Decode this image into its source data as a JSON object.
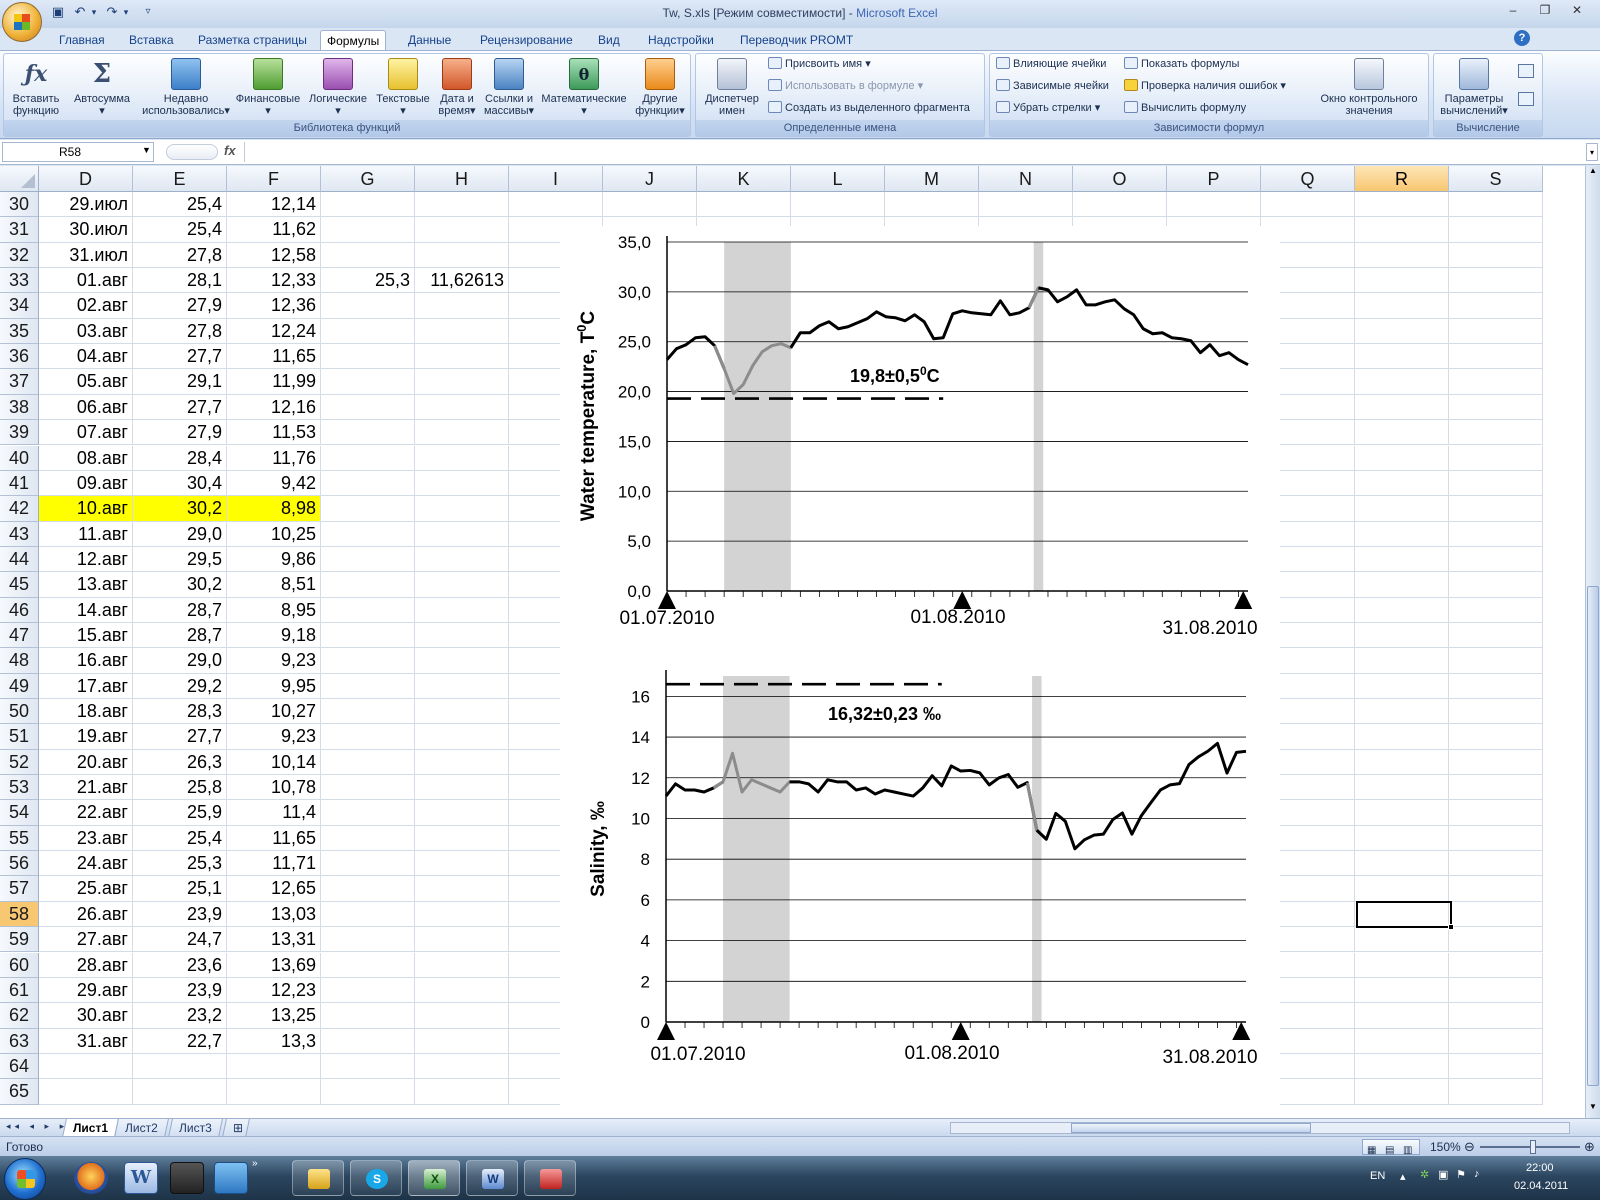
{
  "window": {
    "title_file": "Tw, S.xls  [Режим совместимости] - ",
    "title_app": "Microsoft Excel",
    "help_glyph": "?"
  },
  "ribbon_tabs": [
    "Главная",
    "Вставка",
    "Разметка страницы",
    "Формулы",
    "Данные",
    "Рецензирование",
    "Вид",
    "Надстройки",
    "Переводчик PROMT"
  ],
  "ribbon": {
    "library": {
      "label": "Библиотека функций",
      "insert_fn_line1": "Вставить",
      "insert_fn_line2": "функцию",
      "autosum": "Автосумма",
      "recent_line1": "Недавно",
      "recent_line2": "использовались",
      "financial": "Финансовые",
      "logical": "Логические",
      "text": "Текстовые",
      "datetime_line1": "Дата и",
      "datetime_line2": "время",
      "lookup_line1": "Ссылки и",
      "lookup_line2": "массивы",
      "math": "Математические",
      "other_line1": "Другие",
      "other_line2": "функции"
    },
    "names": {
      "label": "Определенные имена",
      "manager_line1": "Диспетчер",
      "manager_line2": "имен",
      "define": "Присвоить имя",
      "use_in_formula": "Использовать в формуле",
      "create_from_sel": "Создать из выделенного фрагмента"
    },
    "audit": {
      "label": "Зависимости формул",
      "precedents": "Влияющие ячейки",
      "dependents": "Зависимые ячейки",
      "remove_arrows": "Убрать стрелки",
      "show_formulas": "Показать формулы",
      "error_check": "Проверка наличия ошибок",
      "evaluate": "Вычислить формулу",
      "watch_line1": "Окно контрольного",
      "watch_line2": "значения"
    },
    "calc": {
      "label": "Вычисление",
      "options_line1": "Параметры",
      "options_line2": "вычислений"
    }
  },
  "formula_bar": {
    "name_box": "R58",
    "fx": "fx",
    "formula": ""
  },
  "columns": [
    "D",
    "E",
    "F",
    "G",
    "H",
    "I",
    "J",
    "K",
    "L",
    "M",
    "N",
    "O",
    "P",
    "Q",
    "R",
    "S"
  ],
  "selected_column": "R",
  "rows": [
    {
      "n": "30",
      "d": "29.июл",
      "e": "25,4",
      "f": "12,14"
    },
    {
      "n": "31",
      "d": "30.июл",
      "e": "25,4",
      "f": "11,62"
    },
    {
      "n": "32",
      "d": "31.июл",
      "e": "27,8",
      "f": "12,58"
    },
    {
      "n": "33",
      "d": "01.авг",
      "e": "28,1",
      "f": "12,33",
      "g": "25,3",
      "h": "11,62613"
    },
    {
      "n": "34",
      "d": "02.авг",
      "e": "27,9",
      "f": "12,36"
    },
    {
      "n": "35",
      "d": "03.авг",
      "e": "27,8",
      "f": "12,24"
    },
    {
      "n": "36",
      "d": "04.авг",
      "e": "27,7",
      "f": "11,65"
    },
    {
      "n": "37",
      "d": "05.авг",
      "e": "29,1",
      "f": "11,99"
    },
    {
      "n": "38",
      "d": "06.авг",
      "e": "27,7",
      "f": "12,16"
    },
    {
      "n": "39",
      "d": "07.авг",
      "e": "27,9",
      "f": "11,53"
    },
    {
      "n": "40",
      "d": "08.авг",
      "e": "28,4",
      "f": "11,76"
    },
    {
      "n": "41",
      "d": "09.авг",
      "e": "30,4",
      "f": "9,42"
    },
    {
      "n": "42",
      "d": "10.авг",
      "e": "30,2",
      "f": "8,98",
      "hl": true
    },
    {
      "n": "43",
      "d": "11.авг",
      "e": "29,0",
      "f": "10,25"
    },
    {
      "n": "44",
      "d": "12.авг",
      "e": "29,5",
      "f": "9,86"
    },
    {
      "n": "45",
      "d": "13.авг",
      "e": "30,2",
      "f": "8,51"
    },
    {
      "n": "46",
      "d": "14.авг",
      "e": "28,7",
      "f": "8,95"
    },
    {
      "n": "47",
      "d": "15.авг",
      "e": "28,7",
      "f": "9,18"
    },
    {
      "n": "48",
      "d": "16.авг",
      "e": "29,0",
      "f": "9,23"
    },
    {
      "n": "49",
      "d": "17.авг",
      "e": "29,2",
      "f": "9,95"
    },
    {
      "n": "50",
      "d": "18.авг",
      "e": "28,3",
      "f": "10,27"
    },
    {
      "n": "51",
      "d": "19.авг",
      "e": "27,7",
      "f": "9,23"
    },
    {
      "n": "52",
      "d": "20.авг",
      "e": "26,3",
      "f": "10,14"
    },
    {
      "n": "53",
      "d": "21.авг",
      "e": "25,8",
      "f": "10,78"
    },
    {
      "n": "54",
      "d": "22.авг",
      "e": "25,9",
      "f": "11,4"
    },
    {
      "n": "55",
      "d": "23.авг",
      "e": "25,4",
      "f": "11,65"
    },
    {
      "n": "56",
      "d": "24.авг",
      "e": "25,3",
      "f": "11,71"
    },
    {
      "n": "57",
      "d": "25.авг",
      "e": "25,1",
      "f": "12,65"
    },
    {
      "n": "58",
      "d": "26.авг",
      "e": "23,9",
      "f": "13,03",
      "sel": true
    },
    {
      "n": "59",
      "d": "27.авг",
      "e": "24,7",
      "f": "13,31"
    },
    {
      "n": "60",
      "d": "28.авг",
      "e": "23,6",
      "f": "13,69"
    },
    {
      "n": "61",
      "d": "29.авг",
      "e": "23,9",
      "f": "12,23"
    },
    {
      "n": "62",
      "d": "30.авг",
      "e": "23,2",
      "f": "13,25"
    },
    {
      "n": "63",
      "d": "31.авг",
      "e": "22,7",
      "f": "13,3"
    },
    {
      "n": "64",
      "d": "",
      "e": "",
      "f": ""
    },
    {
      "n": "65",
      "d": "",
      "e": "",
      "f": ""
    }
  ],
  "chart_data": [
    {
      "type": "line",
      "ylabel": "Water temperature, T",
      "ylabel_sup": "0",
      "ylabel_unit": "C",
      "ylim": [
        0,
        35
      ],
      "yticks": [
        "0,0",
        "5,0",
        "10,0",
        "15,0",
        "20,0",
        "25,0",
        "30,0",
        "35,0"
      ],
      "date_labels": [
        "01.07.2010",
        "01.08.2010",
        "31.08.2010"
      ],
      "annotation": "19,8±0,5",
      "annotation_sup": "0",
      "annotation_unit": "C",
      "reference_value": 19.3,
      "reference_extent_days": [
        0,
        29
      ],
      "shaded_day_ranges": [
        [
          6,
          13
        ],
        [
          38.5,
          39.5
        ]
      ],
      "grid": true,
      "x_days": [
        0,
        1,
        2,
        3,
        4,
        5,
        6,
        7,
        8,
        9,
        10,
        11,
        12,
        13,
        14,
        15,
        16,
        17,
        18,
        19,
        20,
        21,
        22,
        23,
        24,
        25,
        26,
        27,
        28,
        29,
        30,
        31,
        32,
        33,
        34,
        35,
        36,
        37,
        38,
        39,
        40,
        41,
        42,
        43,
        44,
        45,
        46,
        47,
        48,
        49,
        50,
        51,
        52,
        53,
        54,
        55,
        56,
        57,
        58,
        59,
        60,
        61
      ],
      "values": [
        23.2,
        24.3,
        24.7,
        25.4,
        25.5,
        24.6,
        22.3,
        19.8,
        20.7,
        22.6,
        24.0,
        24.6,
        24.8,
        24.4,
        25.9,
        25.9,
        26.6,
        27.0,
        26.3,
        26.5,
        26.9,
        27.3,
        28.0,
        27.5,
        27.4,
        27.1,
        27.7,
        27.0,
        25.3,
        25.4,
        27.8,
        28.1,
        27.9,
        27.8,
        27.7,
        29.1,
        27.7,
        27.9,
        28.4,
        30.4,
        30.2,
        29.0,
        29.5,
        30.2,
        28.7,
        28.7,
        29.0,
        29.2,
        28.3,
        27.7,
        26.3,
        25.8,
        25.9,
        25.4,
        25.3,
        25.1,
        23.9,
        24.7,
        23.6,
        23.9,
        23.2,
        22.7
      ]
    },
    {
      "type": "line",
      "ylabel": "Salinity, ‰",
      "ylim": [
        0,
        17
      ],
      "yticks": [
        "0",
        "2",
        "4",
        "6",
        "8",
        "10",
        "12",
        "14",
        "16"
      ],
      "date_labels": [
        "01.07.2010",
        "01.08.2010",
        "31.08.2010"
      ],
      "annotation": "16,32±0,23 ‰",
      "reference_value": 16.6,
      "reference_extent_days": [
        0,
        29
      ],
      "shaded_day_ranges": [
        [
          6,
          13
        ],
        [
          38.5,
          39.5
        ]
      ],
      "grid": true,
      "x_days": [
        0,
        1,
        2,
        3,
        4,
        5,
        6,
        7,
        8,
        9,
        10,
        11,
        12,
        13,
        14,
        15,
        16,
        17,
        18,
        19,
        20,
        21,
        22,
        23,
        24,
        25,
        26,
        27,
        28,
        29,
        30,
        31,
        32,
        33,
        34,
        35,
        36,
        37,
        38,
        39,
        40,
        41,
        42,
        43,
        44,
        45,
        46,
        47,
        48,
        49,
        50,
        51,
        52,
        53,
        54,
        55,
        56,
        57,
        58,
        59,
        60,
        61
      ],
      "values": [
        11.1,
        11.7,
        11.4,
        11.4,
        11.3,
        11.5,
        11.8,
        13.2,
        11.3,
        11.9,
        11.7,
        11.5,
        11.3,
        11.8,
        11.8,
        11.7,
        11.3,
        11.9,
        11.8,
        11.8,
        11.4,
        11.5,
        11.2,
        11.4,
        11.3,
        11.2,
        11.1,
        11.5,
        12.1,
        11.6,
        12.58,
        12.33,
        12.36,
        12.24,
        11.65,
        11.99,
        12.16,
        11.53,
        11.76,
        9.42,
        8.98,
        10.25,
        9.86,
        8.51,
        8.95,
        9.18,
        9.23,
        9.95,
        10.27,
        9.23,
        10.14,
        10.78,
        11.4,
        11.65,
        11.71,
        12.65,
        13.03,
        13.31,
        13.69,
        12.23,
        13.25,
        13.3
      ]
    }
  ],
  "sheet_tabs": [
    "Лист1",
    "Лист2",
    "Лист3"
  ],
  "status": {
    "ready": "Готово",
    "zoom": "150%"
  },
  "tray": {
    "lang": "EN",
    "time": "22:00",
    "date": "02.04.2011"
  },
  "colors": {
    "highlight": "#ffff00",
    "selected_header": "#f8c771",
    "shade": "#d3d3d3",
    "ribbon_text": "#15428b"
  }
}
